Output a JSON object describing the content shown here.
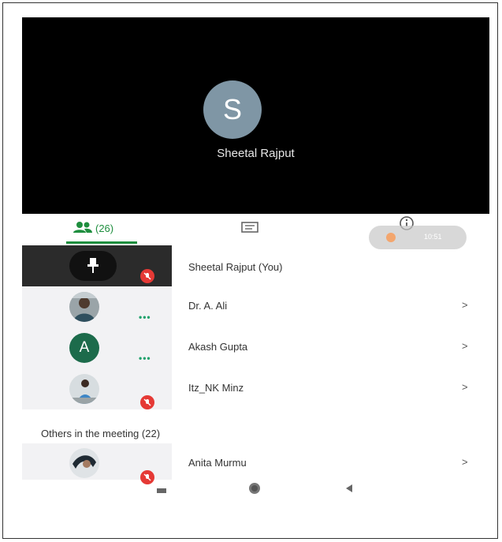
{
  "speaker": {
    "initial": "S",
    "name": "Sheetal Rajput"
  },
  "tabs": {
    "people_count": "(26)"
  },
  "timer": {
    "text": "10:51"
  },
  "participants": [
    {
      "name": "Sheetal Rajput (You)"
    },
    {
      "name": "Dr. A. Ali",
      "chevron": ">"
    },
    {
      "name": "Akash Gupta",
      "initial": "A",
      "chevron": ">"
    },
    {
      "name": "Itz_NK Minz",
      "chevron": ">"
    }
  ],
  "others": {
    "label": "Others in the meeting (22)",
    "items": [
      {
        "name": "Anita Murmu",
        "chevron": ">"
      }
    ]
  },
  "speaking_dots": "•••",
  "colors": {
    "accent": "#1e8e3e",
    "mute": "#e53935",
    "avatar_bg": "#7f96a5",
    "akash_avatar": "#1c6b4b"
  }
}
